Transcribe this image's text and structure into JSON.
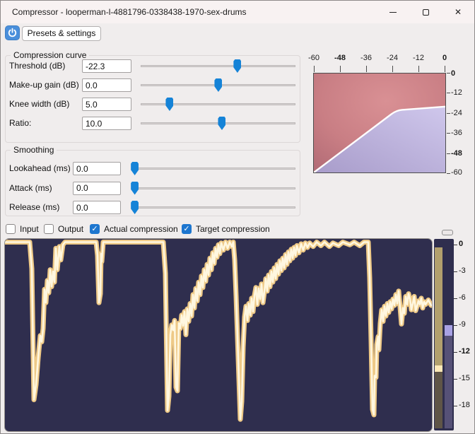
{
  "colors": {
    "accent_blue": "#1583d7",
    "checkbox_blue": "#1d76cf",
    "power_button_blue": "#4a8fdb",
    "window_bg": "#f0eded",
    "titlebar_bg": "#f8f2f2",
    "panel_navy": "#2f2e4e"
  },
  "window": {
    "title": "Compressor - looperman-l-4881796-0338438-1970-sex-drums",
    "close_glyph": "✕"
  },
  "toolbar": {
    "presets_label": "Presets & settings"
  },
  "groups": {
    "compression": {
      "title": "Compression curve",
      "rows": [
        {
          "label": "Threshold (dB)",
          "value": "-22.3",
          "slider_pos": 0.625
        },
        {
          "label": "Make-up gain (dB)",
          "value": "0.0",
          "slider_pos": 0.502
        },
        {
          "label": "Knee width (dB)",
          "value": "5.0",
          "slider_pos": 0.187
        },
        {
          "label": "Ratio:",
          "value": "10.0",
          "slider_pos": 0.525
        }
      ]
    },
    "smoothing": {
      "title": "Smoothing",
      "rows": [
        {
          "label": "Lookahead (ms)",
          "value": "0.0",
          "slider_pos": 0.02
        },
        {
          "label": "Attack (ms)",
          "value": "0.0",
          "slider_pos": 0.02
        },
        {
          "label": "Release (ms)",
          "value": "0.0",
          "slider_pos": 0.02
        }
      ]
    }
  },
  "checkboxes": [
    {
      "label": "Input",
      "checked": false
    },
    {
      "label": "Output",
      "checked": false
    },
    {
      "label": "Actual compression",
      "checked": true
    },
    {
      "label": "Target compression",
      "checked": true
    }
  ],
  "check_glyph": "✓",
  "chart_data": [
    {
      "id": "compression_curve",
      "type": "area",
      "xlim": [
        -60,
        0
      ],
      "ylim": [
        -60,
        0
      ],
      "x_ticks": [
        -60,
        -48,
        -36,
        -24,
        -12,
        0
      ],
      "y_ticks": [
        0,
        -12,
        -24,
        -36,
        -48,
        -60
      ],
      "x_bold_ticks": [
        -48,
        0
      ],
      "y_bold_ticks": [
        0,
        -48
      ],
      "threshold_db": -22.3,
      "ratio": 10,
      "knee_db": 5,
      "region_above_color": "#c97e84",
      "region_below_color": "#b6abd8",
      "line_color": "#ffffff"
    },
    {
      "id": "gain_reduction_history",
      "type": "line",
      "ylim_db": [
        -21,
        0
      ],
      "background": "#2f2e4e",
      "line_outer_color": "#eec987",
      "line_core_color": "#fff7e0",
      "points_x_db": [
        [
          0,
          0
        ],
        [
          34,
          0
        ],
        [
          37,
          -3
        ],
        [
          40,
          -17.7
        ],
        [
          43,
          -16
        ],
        [
          46,
          -13
        ],
        [
          49,
          -10.5
        ],
        [
          51,
          -11.2
        ],
        [
          53,
          -9.7
        ],
        [
          55,
          -5.3
        ],
        [
          57,
          -6.8
        ],
        [
          59,
          -4.3
        ],
        [
          61,
          -5.7
        ],
        [
          63,
          -3.1
        ],
        [
          65,
          -5
        ],
        [
          67,
          -3.3
        ],
        [
          69,
          -4.5
        ],
        [
          71,
          -0.7
        ],
        [
          73,
          -3.1
        ],
        [
          76,
          -0.5
        ],
        [
          78,
          -2
        ],
        [
          81,
          -0.3
        ],
        [
          84,
          0
        ],
        [
          128,
          0
        ],
        [
          130,
          -1.5
        ],
        [
          132,
          -6.8
        ],
        [
          134,
          -5.8
        ],
        [
          135,
          -1.3
        ],
        [
          136,
          -2.2
        ],
        [
          138,
          0
        ],
        [
          223,
          0
        ],
        [
          226,
          -3.5
        ],
        [
          229,
          -18.9
        ],
        [
          231,
          -17.3
        ],
        [
          233,
          -10.4
        ],
        [
          235,
          -9.3
        ],
        [
          237,
          -9.9
        ],
        [
          239,
          -8.8
        ],
        [
          241,
          -16.3
        ],
        [
          243,
          -16.7
        ],
        [
          245,
          -9.1
        ],
        [
          247,
          -9.7
        ],
        [
          249,
          -8.2
        ],
        [
          251,
          -9.4
        ],
        [
          253,
          -7.8
        ],
        [
          255,
          -10.4
        ],
        [
          257,
          -7.5
        ],
        [
          259,
          -8.9
        ],
        [
          261,
          -6.9
        ],
        [
          263,
          -8.3
        ],
        [
          265,
          -5.9
        ],
        [
          267,
          -7.4
        ],
        [
          269,
          -5.2
        ],
        [
          271,
          -6.6
        ],
        [
          273,
          -4.5
        ],
        [
          275,
          -5.9
        ],
        [
          277,
          -3.8
        ],
        [
          279,
          -5.1
        ],
        [
          281,
          -3.1
        ],
        [
          283,
          -4.4
        ],
        [
          285,
          -2.5
        ],
        [
          287,
          -3.7
        ],
        [
          289,
          -1.8
        ],
        [
          291,
          -3.1
        ],
        [
          293,
          -1.2
        ],
        [
          295,
          -2.4
        ],
        [
          297,
          -0.7
        ],
        [
          299,
          -1.7
        ],
        [
          301,
          -0.3
        ],
        [
          303,
          -1.3
        ],
        [
          305,
          -0.1
        ],
        [
          308,
          -0.9
        ],
        [
          311,
          0
        ],
        [
          314,
          -0.7
        ],
        [
          317,
          0
        ],
        [
          320,
          -0.5
        ],
        [
          322,
          0
        ],
        [
          324,
          -2
        ],
        [
          326,
          -6
        ],
        [
          329,
          -13
        ],
        [
          332,
          -19.9
        ],
        [
          334,
          -17.9
        ],
        [
          336,
          -11.8
        ],
        [
          338,
          -8.4
        ],
        [
          340,
          -7.2
        ],
        [
          342,
          -8.8
        ],
        [
          344,
          -6.9
        ],
        [
          346,
          -8.2
        ],
        [
          348,
          -6.3
        ],
        [
          350,
          -7.8
        ],
        [
          352,
          -6
        ],
        [
          354,
          -5.1
        ],
        [
          356,
          -7
        ],
        [
          358,
          -5.2
        ],
        [
          360,
          -6.4
        ],
        [
          362,
          -4.7
        ],
        [
          364,
          -6.8
        ],
        [
          366,
          -5.6
        ],
        [
          368,
          -4.1
        ],
        [
          370,
          -5.5
        ],
        [
          372,
          -3.7
        ],
        [
          374,
          -5
        ],
        [
          376,
          -3.3
        ],
        [
          378,
          -4.5
        ],
        [
          380,
          -2.9
        ],
        [
          382,
          -4.1
        ],
        [
          384,
          -2.5
        ],
        [
          386,
          -3.6
        ],
        [
          388,
          -2.1
        ],
        [
          390,
          -3.2
        ],
        [
          392,
          -1.8
        ],
        [
          394,
          -2.9
        ],
        [
          396,
          -1.4
        ],
        [
          398,
          -2.5
        ],
        [
          400,
          -1.1
        ],
        [
          402,
          -2.1
        ],
        [
          404,
          -0.8
        ],
        [
          406,
          -1.8
        ],
        [
          408,
          -0.6
        ],
        [
          410,
          -1.5
        ],
        [
          412,
          -0.4
        ],
        [
          415,
          -1.2
        ],
        [
          418,
          -0.2
        ],
        [
          421,
          -0.9
        ],
        [
          424,
          -0.1
        ],
        [
          427,
          -0.6
        ],
        [
          430,
          -0.1
        ],
        [
          435,
          -0.5
        ],
        [
          440,
          0
        ],
        [
          446,
          -0.4
        ],
        [
          451,
          0
        ],
        [
          458,
          -0.5
        ],
        [
          463,
          -0.1
        ],
        [
          471,
          -0.4
        ],
        [
          477,
          0
        ],
        [
          487,
          -0.3
        ],
        [
          493,
          0
        ],
        [
          501,
          -0.4
        ],
        [
          507,
          0
        ],
        [
          513,
          0
        ],
        [
          515,
          -4
        ],
        [
          517,
          -11
        ],
        [
          519,
          -18.8
        ],
        [
          521,
          -19.4
        ],
        [
          522,
          -15
        ],
        [
          524,
          -15.2
        ],
        [
          525,
          -11.5
        ],
        [
          527,
          -10.6
        ],
        [
          528,
          -12.1
        ],
        [
          530,
          -9.1
        ],
        [
          532,
          -7.6
        ],
        [
          534,
          -8.9
        ],
        [
          536,
          -7.2
        ],
        [
          538,
          -8.3
        ],
        [
          540,
          -6.9
        ],
        [
          542,
          -7.9
        ],
        [
          544,
          -6.7
        ],
        [
          546,
          -7.5
        ],
        [
          548,
          -6.4
        ],
        [
          550,
          -7.1
        ],
        [
          552,
          -5.9
        ],
        [
          554,
          -6.9
        ],
        [
          556,
          -5.5
        ],
        [
          558,
          -7.3
        ],
        [
          560,
          -9.2
        ],
        [
          562,
          -7.4
        ],
        [
          564,
          -8
        ],
        [
          566,
          -6.1
        ],
        [
          568,
          -7
        ],
        [
          570,
          -5.8
        ],
        [
          572,
          -6.4
        ],
        [
          574,
          -7.6
        ],
        [
          576,
          -6.9
        ],
        [
          578,
          -6.1
        ],
        [
          580,
          -7.7
        ],
        [
          582,
          -7.2
        ],
        [
          584,
          -6.6
        ],
        [
          586,
          -7
        ],
        [
          588,
          -6.3
        ],
        [
          590,
          -7.4
        ],
        [
          592,
          -6.7
        ],
        [
          594,
          -7
        ],
        [
          598,
          -6.5
        ],
        [
          602,
          -7.1
        ]
      ]
    },
    {
      "id": "level_meter",
      "type": "bar",
      "scale_ticks_db": [
        0,
        -3,
        -6,
        -9,
        -12,
        -15,
        -18
      ],
      "bold_ticks_db": [
        0,
        -12
      ],
      "left_bar_segments": [
        {
          "from_db": -0.3,
          "to_db": -13.5,
          "color": "#b2a06d"
        },
        {
          "from_db": -13.5,
          "to_db": -14.2,
          "color": "#ffe9b8"
        },
        {
          "from_db": -14.2,
          "to_db": -20.6,
          "color": "#5f5547"
        }
      ],
      "right_bar_segments": [
        {
          "from_db": -9.0,
          "to_db": -10.2,
          "color": "#a8a1e4"
        },
        {
          "from_db": -10.2,
          "to_db": -20.6,
          "color": "#565177"
        }
      ]
    }
  ]
}
